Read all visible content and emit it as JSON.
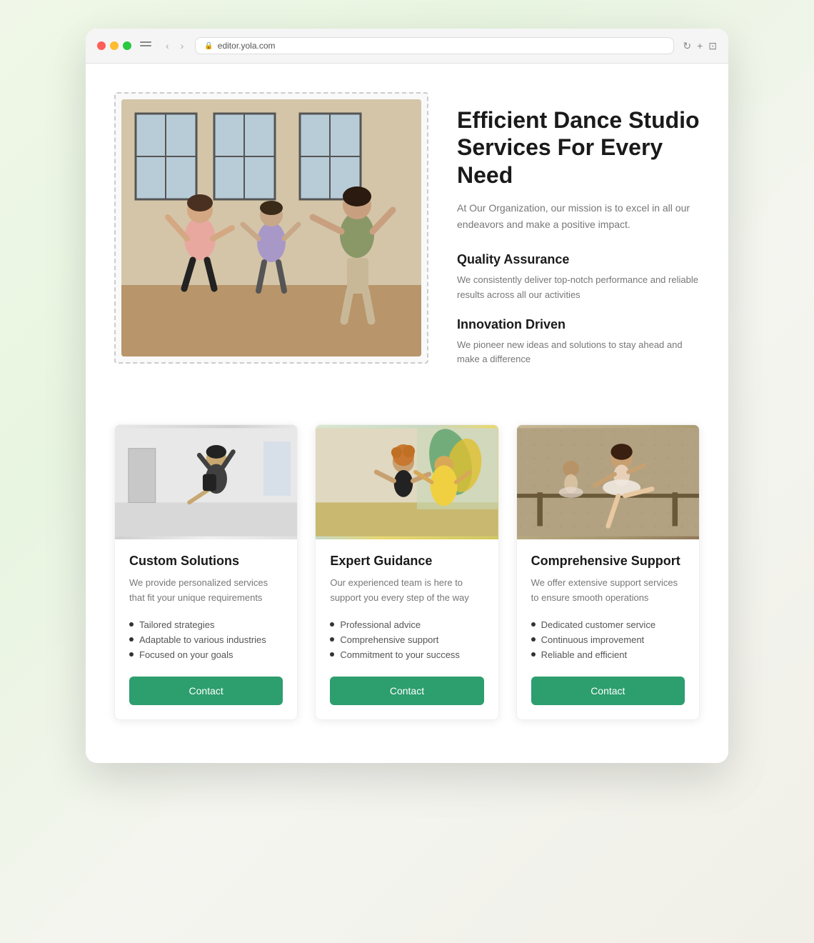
{
  "browser": {
    "url": "editor.yola.com",
    "back_label": "‹",
    "forward_label": "›"
  },
  "hero": {
    "title": "Efficient Dance Studio Services For Every Need",
    "subtitle": "At Our Organization, our mission is to excel in all our endeavors and make a positive impact.",
    "features": [
      {
        "title": "Quality Assurance",
        "desc": "We consistently deliver top-notch performance and reliable results across all our activities"
      },
      {
        "title": "Innovation Driven",
        "desc": "We pioneer new ideas and solutions to stay ahead and make a difference"
      }
    ]
  },
  "cards": [
    {
      "id": "card-1",
      "title": "Custom Solutions",
      "desc": "We provide personalized services that fit your unique requirements",
      "list_items": [
        "Tailored strategies",
        "Adaptable to various industries",
        "Focused on your goals"
      ],
      "button_label": "Contact"
    },
    {
      "id": "card-2",
      "title": "Expert Guidance",
      "desc": "Our experienced team is here to support you every step of the way",
      "list_items": [
        "Professional advice",
        "Comprehensive support",
        "Commitment to your success"
      ],
      "button_label": "Contact"
    },
    {
      "id": "card-3",
      "title": "Comprehensive Support",
      "desc": "We offer extensive support services to ensure smooth operations",
      "list_items": [
        "Dedicated customer service",
        "Continuous improvement",
        "Reliable and efficient"
      ],
      "button_label": "Contact"
    }
  ]
}
